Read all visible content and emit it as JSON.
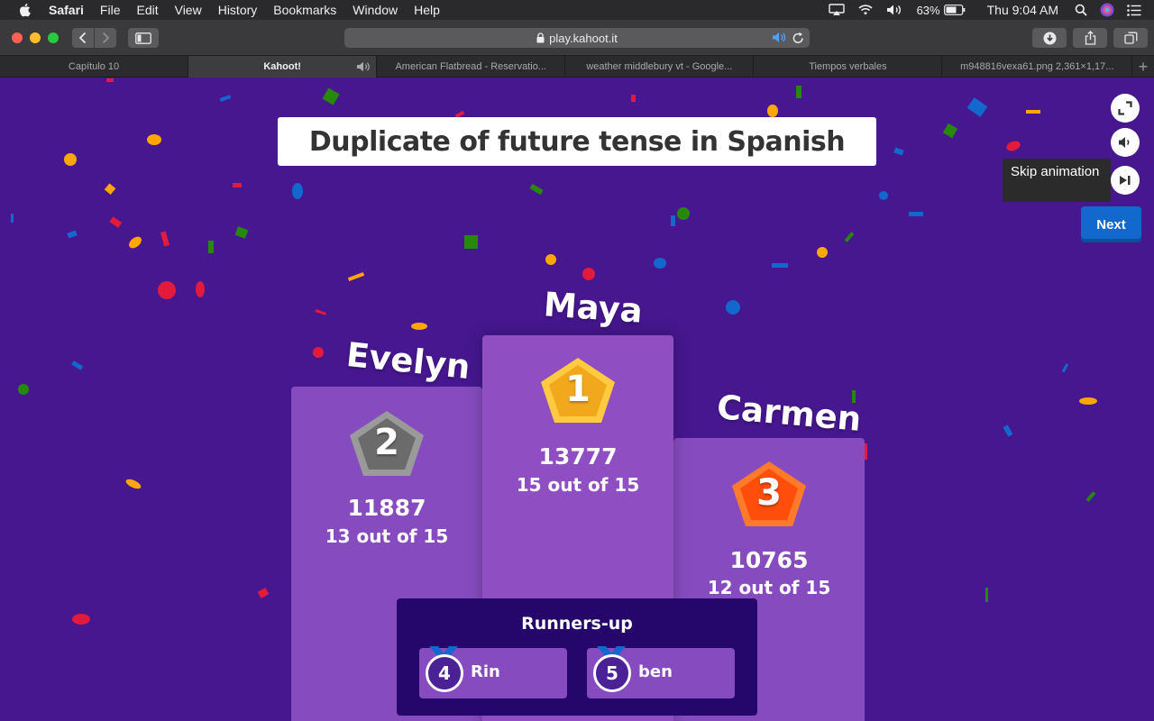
{
  "menubar": {
    "app": "Safari",
    "items": [
      "File",
      "Edit",
      "View",
      "History",
      "Bookmarks",
      "Window",
      "Help"
    ],
    "battery": "63%",
    "clock": "Thu 9:04 AM"
  },
  "browser": {
    "url": "play.kahoot.it",
    "tabs": [
      {
        "label": "Capítulo 10"
      },
      {
        "label": "Kahoot!"
      },
      {
        "label": "American Flatbread - Reservatio..."
      },
      {
        "label": "weather middlebury vt - Google..."
      },
      {
        "label": "Tiempos verbales"
      },
      {
        "label": "m948816vexa61.png 2,361×1,17..."
      }
    ]
  },
  "game": {
    "title": "Duplicate of future tense in Spanish",
    "tooltip": "Skip animation",
    "next_label": "Next",
    "podium": {
      "first": {
        "rank": "1",
        "name": "Maya",
        "score": "13777",
        "correct": "15 out of 15"
      },
      "second": {
        "rank": "2",
        "name": "Evelyn",
        "score": "11887",
        "correct": "13 out of 15"
      },
      "third": {
        "rank": "3",
        "name": "Carmen",
        "score": "10765",
        "correct": "12 out of 15"
      }
    },
    "runners_up": {
      "heading": "Runners-up",
      "players": [
        {
          "rank": "4",
          "name": "Rin"
        },
        {
          "rank": "5",
          "name": "ben"
        }
      ]
    }
  },
  "colors": {
    "background": "#46178f",
    "podium": "#864cbf",
    "gold": "#f2a81d",
    "silver": "#6b6b6b",
    "bronze": "#ff4e0c",
    "next_button": "#1368ce",
    "runners_panel": "#25076b"
  }
}
